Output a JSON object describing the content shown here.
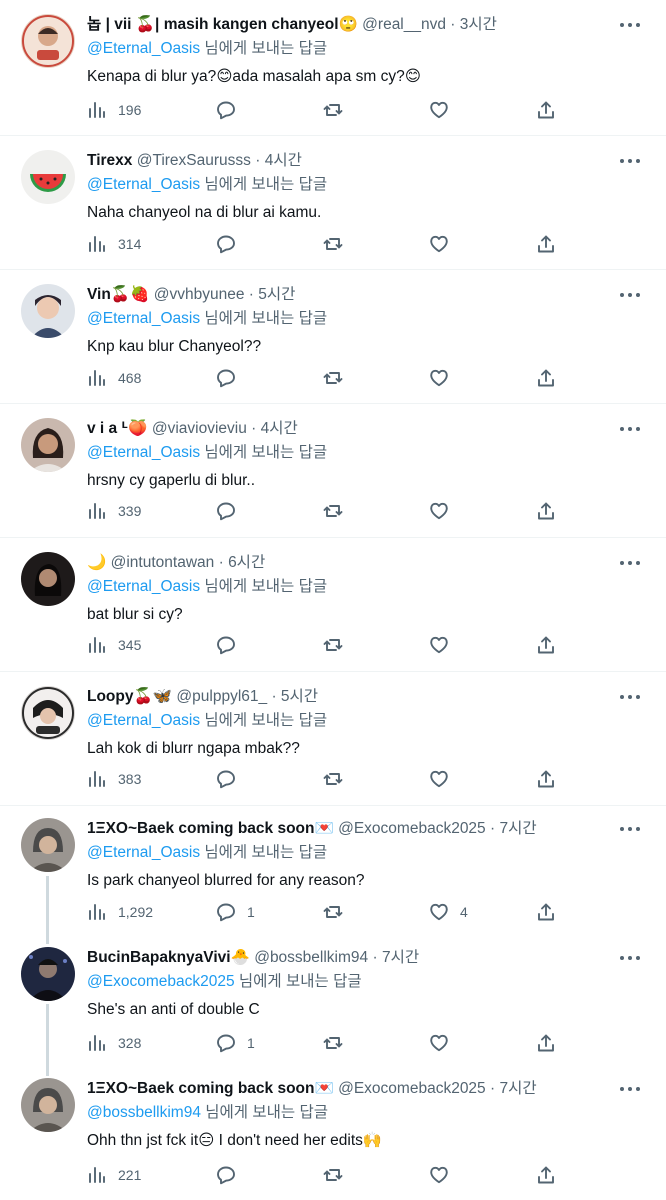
{
  "reply_suffix": "님에게 보내는 답글",
  "icons": {
    "views": "bar-chart-icon",
    "reply": "speech-bubble-icon",
    "retweet": "retweet-icon",
    "like": "heart-icon",
    "share": "share-upload-icon",
    "more": "more-horizontal-icon"
  },
  "colors": {
    "link": "#1d9bf0",
    "secondary": "#536471",
    "text": "#0f1419",
    "divider": "#eff3f4"
  },
  "tweets": [
    {
      "name": "놉 | vii 🍒| masih kangen chanyeol🙄",
      "handle": "@real__nvd",
      "dot": "·",
      "time": "3시간",
      "reply_to": "@Eternal_Oasis",
      "text": "Kenapa di blur ya?😊ada masalah apa sm cy?😊",
      "views": "196",
      "replies": "",
      "retweets": "",
      "likes": ""
    },
    {
      "name": "Tirexx",
      "handle": "@TirexSaurusss",
      "dot": "·",
      "time": "4시간",
      "reply_to": "@Eternal_Oasis",
      "text": "Naha chanyeol na di blur ai kamu.",
      "views": "314",
      "replies": "",
      "retweets": "",
      "likes": ""
    },
    {
      "name": "Vin🍒🍓",
      "handle": "@vvhbyunee",
      "dot": "·",
      "time": "5시간",
      "reply_to": "@Eternal_Oasis",
      "text": "Knp kau blur Chanyeol??",
      "views": "468",
      "replies": "",
      "retweets": "",
      "likes": ""
    },
    {
      "name": "v i a ᒻ🍑",
      "handle": "@viaviovieviu",
      "dot": "·",
      "time": "4시간",
      "reply_to": "@Eternal_Oasis",
      "text": "hrsny cy gaperlu di blur..",
      "views": "339",
      "replies": "",
      "retweets": "",
      "likes": ""
    },
    {
      "name": "🌙",
      "handle": "@intutontawan",
      "dot": "·",
      "time": "6시간",
      "reply_to": "@Eternal_Oasis",
      "text": "bat blur si cy?",
      "views": "345",
      "replies": "",
      "retweets": "",
      "likes": ""
    },
    {
      "name": "Loopy🍒🦋",
      "handle": "@pulppyl61_",
      "dot": "·",
      "time": "5시간",
      "reply_to": "@Eternal_Oasis",
      "text": "Lah kok di blurr ngapa mbak??",
      "views": "383",
      "replies": "",
      "retweets": "",
      "likes": ""
    },
    {
      "name": "1ΞXO~Baek coming back soon💌",
      "handle": "@Exocomeback2025",
      "dot": "·",
      "time": "7시간",
      "reply_to": "@Eternal_Oasis",
      "text": "Is park chanyeol blurred for any reason?",
      "views": "1,292",
      "replies": "1",
      "retweets": "",
      "likes": "4"
    },
    {
      "name": "BucinBapaknyaVivi🐣",
      "handle": "@bossbellkim94",
      "dot": "·",
      "time": "7시간",
      "reply_to": "@Exocomeback2025",
      "text": "She's an anti of double C",
      "views": "328",
      "replies": "1",
      "retweets": "",
      "likes": ""
    },
    {
      "name": "1ΞXO~Baek coming back soon💌",
      "handle": "@Exocomeback2025",
      "dot": "·",
      "time": "7시간",
      "reply_to": "@bossbellkim94",
      "text": "Ohh thn jst fck it😑 I don't need her edits🙌",
      "views": "221",
      "replies": "",
      "retweets": "",
      "likes": ""
    }
  ]
}
